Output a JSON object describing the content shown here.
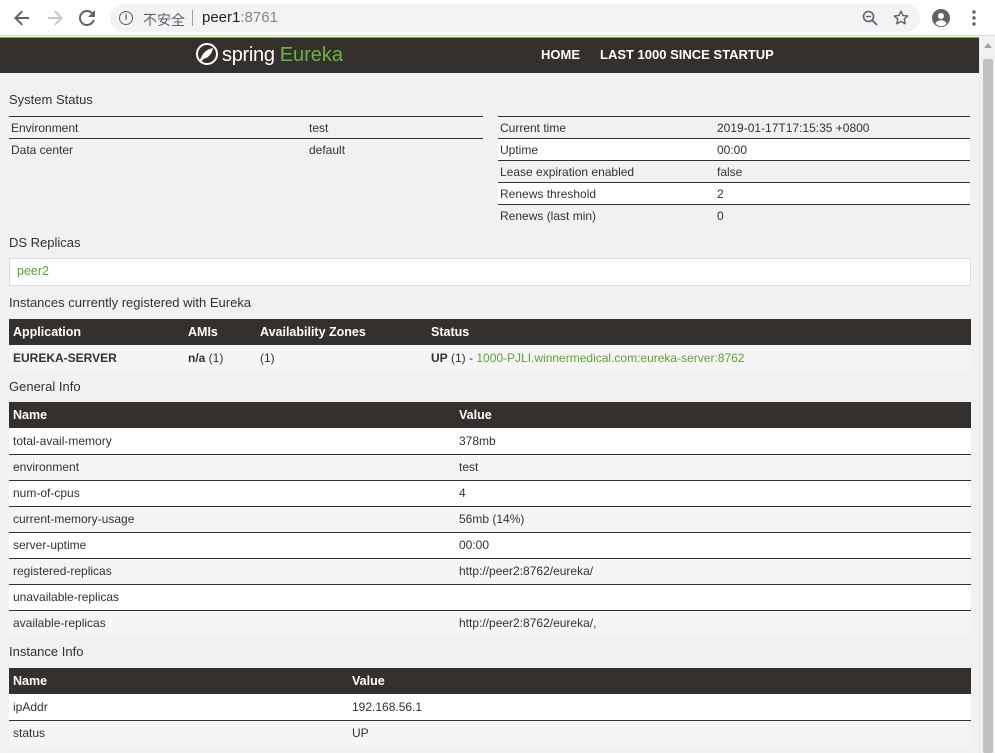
{
  "browser": {
    "insecure_label": "不安全",
    "url_host": "peer1",
    "url_port": ":8761"
  },
  "nav": {
    "logo_spring": "spring",
    "logo_eureka": "Eureka",
    "home": "HOME",
    "last1000": "LAST 1000 SINCE STARTUP"
  },
  "system_status": {
    "heading": "System Status",
    "left": [
      {
        "k": "Environment",
        "v": "test"
      },
      {
        "k": "Data center",
        "v": "default"
      }
    ],
    "right": [
      {
        "k": "Current time",
        "v": "2019-01-17T17:15:35 +0800"
      },
      {
        "k": "Uptime",
        "v": "00:00"
      },
      {
        "k": "Lease expiration enabled",
        "v": "false"
      },
      {
        "k": "Renews threshold",
        "v": "2"
      },
      {
        "k": "Renews (last min)",
        "v": "0"
      }
    ]
  },
  "ds_replicas": {
    "heading": "DS Replicas",
    "items": [
      "peer2"
    ]
  },
  "instances": {
    "heading": "Instances currently registered with Eureka",
    "headers": [
      "Application",
      "AMIs",
      "Availability Zones",
      "Status"
    ],
    "rows": [
      {
        "app": "EUREKA-SERVER",
        "amis_bold": "n/a",
        "amis_count": " (1)",
        "zones": "(1)",
        "status_bold": "UP",
        "status_count": " (1) - ",
        "status_link": "1000-PJLI.winnermedical.com:eureka-server:8762"
      }
    ]
  },
  "general_info": {
    "heading": "General Info",
    "headers": [
      "Name",
      "Value"
    ],
    "rows": [
      [
        "total-avail-memory",
        "378mb"
      ],
      [
        "environment",
        "test"
      ],
      [
        "num-of-cpus",
        "4"
      ],
      [
        "current-memory-usage",
        "56mb (14%)"
      ],
      [
        "server-uptime",
        "00:00"
      ],
      [
        "registered-replicas",
        "http://peer2:8762/eureka/"
      ],
      [
        "unavailable-replicas",
        ""
      ],
      [
        "available-replicas",
        "http://peer2:8762/eureka/,"
      ]
    ]
  },
  "instance_info": {
    "heading": "Instance Info",
    "headers": [
      "Name",
      "Value"
    ],
    "rows": [
      [
        "ipAddr",
        "192.168.56.1"
      ],
      [
        "status",
        "UP"
      ]
    ]
  },
  "colors": {
    "accent": "#6db33f",
    "dark": "#34302d"
  }
}
